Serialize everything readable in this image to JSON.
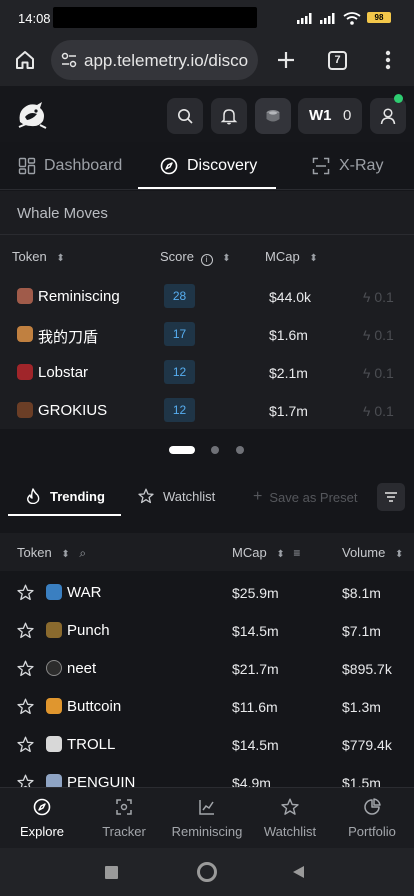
{
  "status": {
    "time": "14:08",
    "battery": "98"
  },
  "browser": {
    "url": "app.telemetry.io/disco",
    "tabs_count": "7"
  },
  "header": {
    "wallet_label": "W1",
    "wallet_count": "0"
  },
  "nav_tabs": [
    {
      "label": "Dashboard"
    },
    {
      "label": "Discovery"
    },
    {
      "label": "X-Ray"
    }
  ],
  "whale": {
    "title": "Whale Moves",
    "headers": {
      "token": "Token",
      "score": "Score",
      "mcap": "MCap"
    },
    "rows": [
      {
        "name": "Reminiscing",
        "score": "28",
        "mcap": "$44.0k",
        "fee": "0.1",
        "img": "#a05b4a"
      },
      {
        "name": "我的刀盾",
        "score": "17",
        "mcap": "$1.6m",
        "fee": "0.1",
        "img": "#c08040"
      },
      {
        "name": "Lobstar",
        "score": "12",
        "mcap": "$2.1m",
        "fee": "0.1",
        "img": "#a0252a"
      },
      {
        "name": "GROKIUS",
        "score": "12",
        "mcap": "$1.7m",
        "fee": "0.1",
        "img": "#6b3e26"
      }
    ]
  },
  "trend_tabs": {
    "trending": "Trending",
    "watchlist": "Watchlist",
    "preset": "Save as Preset"
  },
  "list": {
    "headers": {
      "token": "Token",
      "mcap": "MCap",
      "volume": "Volume"
    },
    "rows": [
      {
        "name": "WAR",
        "mcap": "$25.9m",
        "volume": "$8.1m",
        "img": "#3a7fc1"
      },
      {
        "name": "Punch",
        "mcap": "$14.5m",
        "volume": "$7.1m",
        "img": "#8a6a2e"
      },
      {
        "name": "neet",
        "mcap": "$21.7m",
        "volume": "$895.7k",
        "img": "#2c2c2c"
      },
      {
        "name": "Buttcoin",
        "mcap": "$11.6m",
        "volume": "$1.3m",
        "img": "#e0962e"
      },
      {
        "name": "TROLL",
        "mcap": "$14.5m",
        "volume": "$779.4k",
        "img": "#d8d8d8"
      },
      {
        "name": "PENGUIN",
        "mcap": "$4.9m",
        "volume": "$1.5m",
        "img": "#8fa4c4"
      }
    ]
  },
  "bottom_nav": [
    {
      "label": "Explore"
    },
    {
      "label": "Tracker"
    },
    {
      "label": "Reminiscing"
    },
    {
      "label": "Watchlist"
    },
    {
      "label": "Portfolio"
    }
  ],
  "colors": {
    "accent_blue": "#57aef0",
    "online_green": "#2ecc71",
    "battery_yellow": "#f3c74a"
  }
}
